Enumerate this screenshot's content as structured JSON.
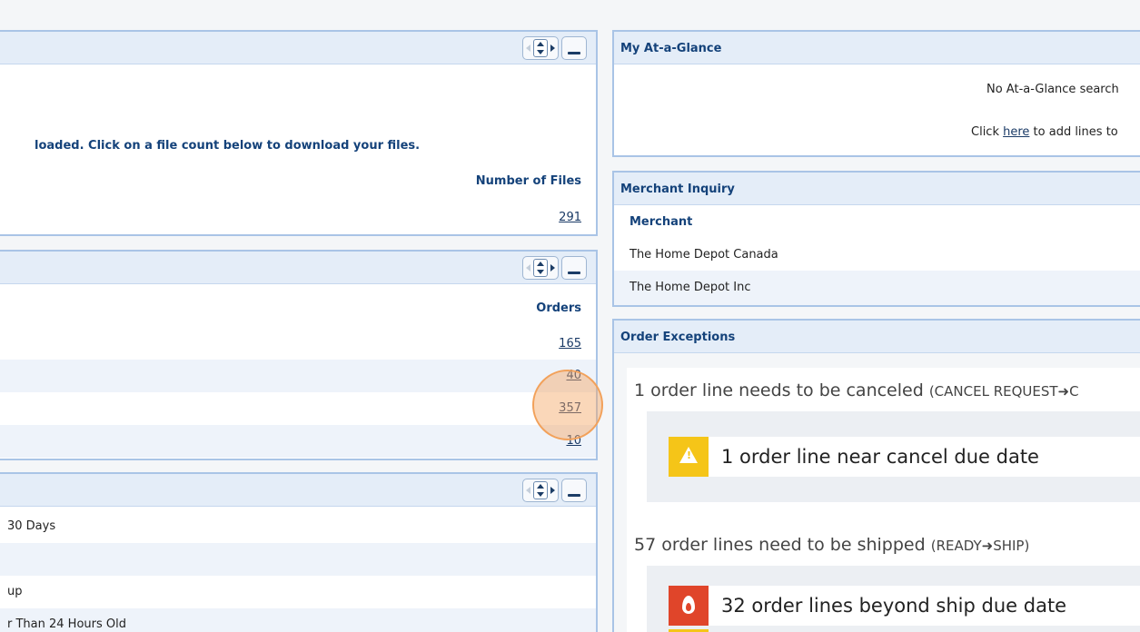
{
  "left": {
    "downloads": {
      "message": "loaded. Click on a file count below to download your files.",
      "col_header": "Number of Files",
      "rows": [
        {
          "value": "291"
        }
      ]
    },
    "orders": {
      "col_header": "Orders",
      "rows": [
        {
          "value": "165"
        },
        {
          "value": "40"
        },
        {
          "value": "357"
        },
        {
          "value": "10"
        }
      ]
    },
    "third": {
      "rows": [
        {
          "label": "30 Days"
        },
        {
          "label": ""
        },
        {
          "label": "up"
        },
        {
          "label": "r Than 24 Hours Old"
        }
      ]
    }
  },
  "right": {
    "glance": {
      "title": "My At-a-Glance",
      "empty_text": "No At-a-Glance search",
      "add_prefix": "Click ",
      "add_link": "here",
      "add_suffix": " to add lines to"
    },
    "merchant": {
      "title": "Merchant Inquiry",
      "col_header": "Merchant",
      "rows": [
        {
          "name": "The Home Depot Canada"
        },
        {
          "name": "The Home Depot Inc"
        }
      ]
    },
    "exceptions": {
      "title": "Order Exceptions",
      "groups": [
        {
          "title": "1 order line needs to be canceled",
          "subtitle": "(CANCEL REQUEST➜C",
          "items": [
            {
              "icon": "warning-icon",
              "color": "#f5c518",
              "text": "1 order line near cancel due date"
            }
          ]
        },
        {
          "title": "57 order lines need to be shipped",
          "subtitle": "(READY➜SHIP)",
          "items": [
            {
              "icon": "fire-icon",
              "color": "#e0452a",
              "text": "32 order lines beyond ship due date"
            }
          ]
        }
      ]
    }
  },
  "colors": {
    "panel_border": "#a9c4e6",
    "header_bg": "#e4edf8",
    "title": "#14427a",
    "highlight": "#f2a15a"
  }
}
